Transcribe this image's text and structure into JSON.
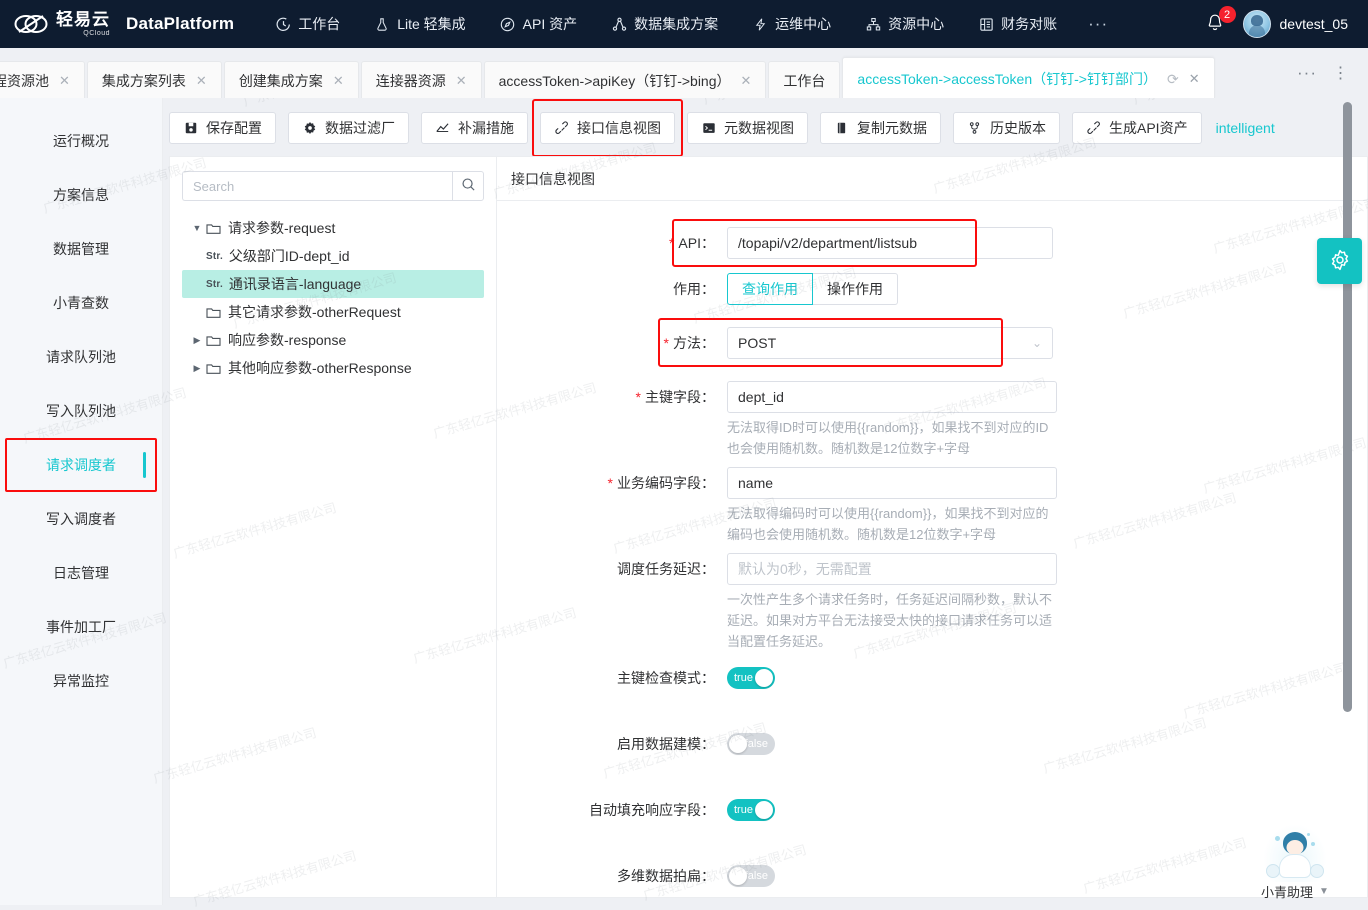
{
  "topnav": {
    "brand_cn": "轻易云",
    "brand_sub": "QCloud",
    "brand_en": "DataPlatform",
    "items": [
      {
        "label": "工作台",
        "icon": "clock-icon"
      },
      {
        "label": "Lite 轻集成",
        "icon": "flask-icon"
      },
      {
        "label": "API 资产",
        "icon": "compass-icon"
      },
      {
        "label": "数据集成方案",
        "icon": "sitemap-icon"
      },
      {
        "label": "运维中心",
        "icon": "bolt-icon"
      },
      {
        "label": "资源中心",
        "icon": "org-icon"
      },
      {
        "label": "财务对账",
        "icon": "ledger-icon"
      }
    ],
    "more": "···",
    "notification_count": "2",
    "username": "devtest_05"
  },
  "tabs": [
    {
      "label": "程资源池",
      "closable": true,
      "active": false
    },
    {
      "label": "集成方案列表",
      "closable": true,
      "active": false
    },
    {
      "label": "创建集成方案",
      "closable": true,
      "active": false
    },
    {
      "label": "连接器资源",
      "closable": true,
      "active": false
    },
    {
      "label": "accessToken->apiKey（钉钉->bing）",
      "closable": true,
      "active": false
    },
    {
      "label": "工作台",
      "closable": false,
      "active": false
    },
    {
      "label": "accessToken->accessToken（钉钉->钉钉部门）",
      "closable": true,
      "active": true
    }
  ],
  "tabbar_actions": {
    "more": "···",
    "menu": "⋮",
    "reload": "⟳",
    "close": "✕"
  },
  "sidebar": {
    "items": [
      {
        "label": "运行概况",
        "active": false
      },
      {
        "label": "方案信息",
        "active": false
      },
      {
        "label": "数据管理",
        "active": false
      },
      {
        "label": "小青查数",
        "active": false
      },
      {
        "label": "请求队列池",
        "active": false
      },
      {
        "label": "写入队列池",
        "active": false
      },
      {
        "label": "请求调度者",
        "active": true,
        "highlighted": true
      },
      {
        "label": "写入调度者",
        "active": false
      },
      {
        "label": "日志管理",
        "active": false
      },
      {
        "label": "事件加工厂",
        "active": false
      },
      {
        "label": "异常监控",
        "active": false
      }
    ]
  },
  "toolbar": {
    "buttons": [
      {
        "label": "保存配置",
        "icon": "save-icon",
        "highlighted": false
      },
      {
        "label": "数据过滤厂",
        "icon": "gear-icon",
        "highlighted": false
      },
      {
        "label": "补漏措施",
        "icon": "chart-icon",
        "highlighted": false
      },
      {
        "label": "接口信息视图",
        "icon": "link-icon",
        "highlighted": true
      },
      {
        "label": "元数据视图",
        "icon": "terminal-icon",
        "highlighted": false
      },
      {
        "label": "复制元数据",
        "icon": "copy-icon",
        "highlighted": false
      },
      {
        "label": "历史版本",
        "icon": "branch-icon",
        "highlighted": false
      },
      {
        "label": "生成API资产",
        "icon": "link-icon",
        "highlighted": false
      }
    ],
    "link": "intelligent"
  },
  "tree": {
    "search_placeholder": "Search",
    "search_value": "",
    "search_icon": "search-icon",
    "nodes": [
      {
        "label": "请求参数-request",
        "type": "folder",
        "caret": "down",
        "indent": 0,
        "selected": false
      },
      {
        "label": "父级部门ID-dept_id",
        "type": "field",
        "tag": "Str.",
        "indent": 1,
        "selected": false
      },
      {
        "label": "通讯录语言-language",
        "type": "field",
        "tag": "Str.",
        "indent": 1,
        "selected": true
      },
      {
        "label": "其它请求参数-otherRequest",
        "type": "folder",
        "caret": "none",
        "indent": 0,
        "selected": false
      },
      {
        "label": "响应参数-response",
        "type": "folder",
        "caret": "right",
        "indent": 0,
        "selected": false
      },
      {
        "label": "其他响应参数-otherResponse",
        "type": "folder",
        "caret": "right",
        "indent": 0,
        "selected": false
      }
    ]
  },
  "form": {
    "pane_title": "接口信息视图",
    "api": {
      "label": "API：",
      "value": "/topapi/v2/department/listsub",
      "required": true,
      "highlighted": true
    },
    "role": {
      "label": "作用：",
      "options": [
        "查询作用",
        "操作作用"
      ],
      "selected": "查询作用"
    },
    "method": {
      "label": "方法：",
      "value": "POST",
      "required": true,
      "highlighted": true,
      "caret": "⌄"
    },
    "primary_key": {
      "label": "主键字段：",
      "value": "dept_id",
      "required": true,
      "hint": "无法取得ID时可以使用{{random}}，如果找不到对应的ID也会使用随机数。随机数是12位数字+字母"
    },
    "biz_code": {
      "label": "业务编码字段：",
      "value": "name",
      "required": true,
      "hint": "无法取得编码时可以使用{{random}}，如果找不到对应的编码也会使用随机数。随机数是12位数字+字母"
    },
    "task_delay": {
      "label": "调度任务延迟：",
      "value": "",
      "placeholder": "默认为0秒，无需配置",
      "hint": "一次性产生多个请求任务时，任务延迟间隔秒数，默认不延迟。如果对方平台无法接受太快的接口请求任务可以适当配置任务延迟。"
    },
    "switches": [
      {
        "label": "主键检查模式：",
        "value": "true",
        "on": true
      },
      {
        "label": "启用数据建模：",
        "value": "false",
        "on": false
      },
      {
        "label": "自动填充响应字段：",
        "value": "true",
        "on": true
      },
      {
        "label": "多维数据拍扁：",
        "value": "false",
        "on": false
      }
    ]
  },
  "fab": {
    "icon": "gear-icon"
  },
  "assistant": {
    "label": "小青助理",
    "caret": "▼",
    "icon": "assistant-avatar"
  },
  "watermark": "广东轻亿云软件科技有限公司",
  "colors": {
    "accent": "#17c7cf",
    "switch_on": "#13c2c2",
    "highlight_box": "#fa0d0d",
    "nav_bg": "#0e1c30",
    "tree_selected": "#b8eee4",
    "required_star": "#f5222d"
  }
}
